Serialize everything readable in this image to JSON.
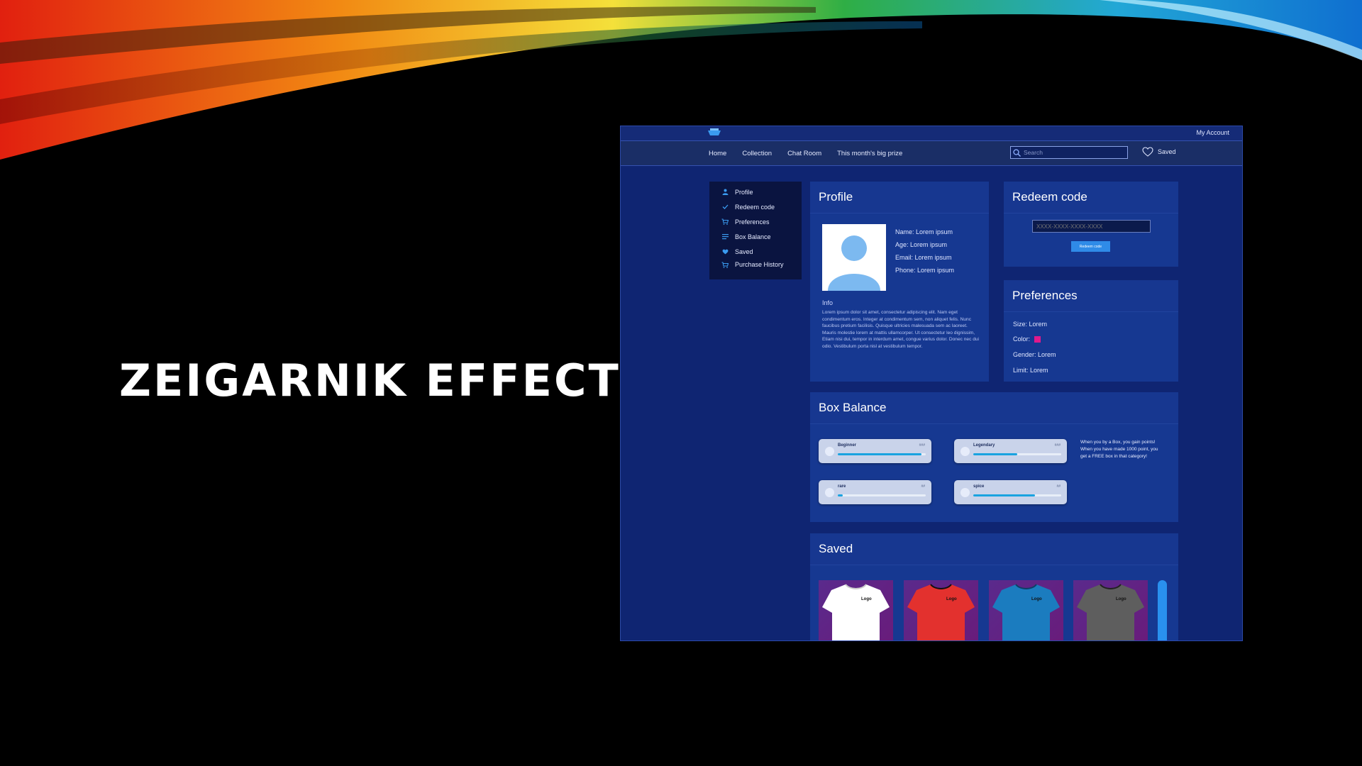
{
  "slide": {
    "title": "ZEIGARNIK EFFECT"
  },
  "topbar": {
    "my_account": "My Account"
  },
  "nav": {
    "links": [
      "Home",
      "Collection",
      "Chat Room",
      "This month's big prize"
    ],
    "search_placeholder": "Search",
    "saved_label": "Saved"
  },
  "side_menu": {
    "items": [
      {
        "label": "Profile",
        "icon": "person-icon"
      },
      {
        "label": "Redeem code",
        "icon": "check-icon"
      },
      {
        "label": "Preferences",
        "icon": "cart-icon"
      },
      {
        "label": "Box Balance",
        "icon": "list-icon"
      },
      {
        "label": "Saved",
        "icon": "heart-icon"
      },
      {
        "label": "Purchase History",
        "icon": "cart-icon"
      }
    ]
  },
  "profile": {
    "title": "Profile",
    "fields": [
      "Name: Lorem ipsum",
      "Age: Lorem ipsum",
      "Email: Lorem ipsum",
      "Phone: Lorem ipsum"
    ],
    "info_label": "Info",
    "info_text": "Lorem ipsum dolor sit amet, consectetur adipiscing elit. Nam eget condimentum eros. Integer at condimentum sem, non aliquet felis. Nunc faucibus pretium facilisis. Quisque ultricies malesuada sem ac laoreet. Mauris molestie lorem at mattis ullamcorper. Ut consectetur leo dignissim, Etiam nisi dui, tempor in interdum amet, congue varius dolor. Donec nec dui odio. Vestibulum porta nisl at vestibulum tempor."
  },
  "redeem": {
    "title": "Redeem code",
    "code_placeholder": "XXXX-XXXX-XXXX-XXXX",
    "button_label": "Redeem code"
  },
  "preferences": {
    "title": "Preferences",
    "size": "Size: Lorem",
    "color_label": "Color:",
    "color_value": "#e0198b",
    "gender": "Gender: Lorem",
    "limit": "Limit: Lorem"
  },
  "box_balance": {
    "title": "Box Balance",
    "boxes": [
      {
        "name": "Beginner",
        "count": "###",
        "progress": 0.95
      },
      {
        "name": "Legendary",
        "count": "###",
        "progress": 0.5
      },
      {
        "name": "rare",
        "count": "##",
        "progress": 0.06
      },
      {
        "name": "spice",
        "count": "##",
        "progress": 0.7
      }
    ],
    "note": "When you by a Box, you gain points! When you have made 1000 point, you get a FREE box in that category!"
  },
  "saved": {
    "title": "Saved",
    "items": [
      {
        "color": "#ffffff",
        "logo": "Logo"
      },
      {
        "color": "#e3312e",
        "logo": "Logo"
      },
      {
        "color": "#1b7cbf",
        "logo": "Logo"
      },
      {
        "color": "#5e5e5e",
        "logo": "Logo"
      }
    ]
  },
  "colors": {
    "accent": "#2f8be8",
    "panel": "#163891",
    "background": "#0f2572"
  }
}
